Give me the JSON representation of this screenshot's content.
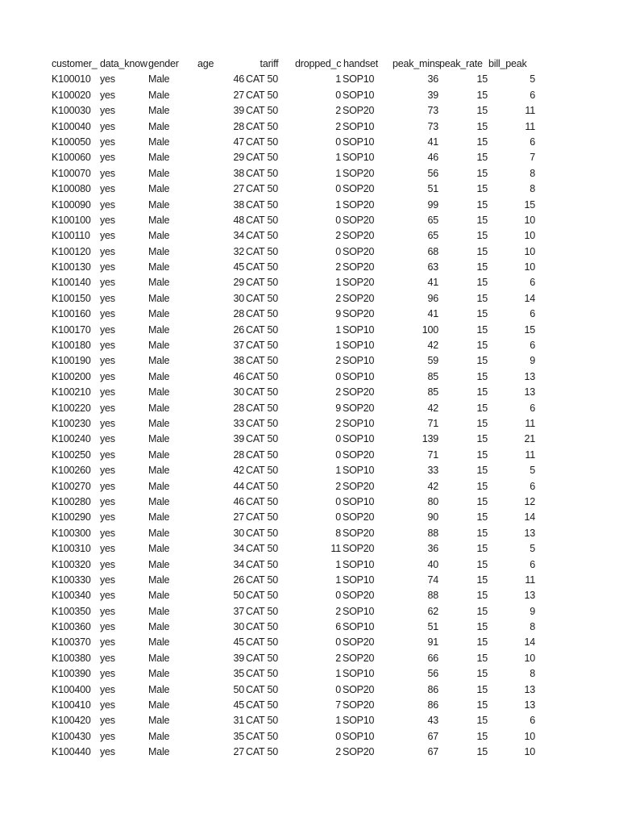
{
  "sheet": {
    "headers": [
      "customer_",
      "data_know",
      "gender",
      "age",
      "tariff",
      "dropped_c",
      "handset",
      "peak_mins",
      "peak_rate",
      "bill_peak"
    ],
    "rows": [
      [
        "K100010",
        "yes",
        "Male",
        "46",
        "CAT 50",
        "1",
        "SOP10",
        "36",
        "15",
        "5"
      ],
      [
        "K100020",
        "yes",
        "Male",
        "27",
        "CAT 50",
        "0",
        "SOP10",
        "39",
        "15",
        "6"
      ],
      [
        "K100030",
        "yes",
        "Male",
        "39",
        "CAT 50",
        "2",
        "SOP20",
        "73",
        "15",
        "11"
      ],
      [
        "K100040",
        "yes",
        "Male",
        "28",
        "CAT 50",
        "2",
        "SOP10",
        "73",
        "15",
        "11"
      ],
      [
        "K100050",
        "yes",
        "Male",
        "47",
        "CAT 50",
        "0",
        "SOP10",
        "41",
        "15",
        "6"
      ],
      [
        "K100060",
        "yes",
        "Male",
        "29",
        "CAT 50",
        "1",
        "SOP10",
        "46",
        "15",
        "7"
      ],
      [
        "K100070",
        "yes",
        "Male",
        "38",
        "CAT 50",
        "1",
        "SOP20",
        "56",
        "15",
        "8"
      ],
      [
        "K100080",
        "yes",
        "Male",
        "27",
        "CAT 50",
        "0",
        "SOP20",
        "51",
        "15",
        "8"
      ],
      [
        "K100090",
        "yes",
        "Male",
        "38",
        "CAT 50",
        "1",
        "SOP20",
        "99",
        "15",
        "15"
      ],
      [
        "K100100",
        "yes",
        "Male",
        "48",
        "CAT 50",
        "0",
        "SOP20",
        "65",
        "15",
        "10"
      ],
      [
        "K100110",
        "yes",
        "Male",
        "34",
        "CAT 50",
        "2",
        "SOP20",
        "65",
        "15",
        "10"
      ],
      [
        "K100120",
        "yes",
        "Male",
        "32",
        "CAT 50",
        "0",
        "SOP20",
        "68",
        "15",
        "10"
      ],
      [
        "K100130",
        "yes",
        "Male",
        "45",
        "CAT 50",
        "2",
        "SOP20",
        "63",
        "15",
        "10"
      ],
      [
        "K100140",
        "yes",
        "Male",
        "29",
        "CAT 50",
        "1",
        "SOP20",
        "41",
        "15",
        "6"
      ],
      [
        "K100150",
        "yes",
        "Male",
        "30",
        "CAT 50",
        "2",
        "SOP20",
        "96",
        "15",
        "14"
      ],
      [
        "K100160",
        "yes",
        "Male",
        "28",
        "CAT 50",
        "9",
        "SOP20",
        "41",
        "15",
        "6"
      ],
      [
        "K100170",
        "yes",
        "Male",
        "26",
        "CAT 50",
        "1",
        "SOP10",
        "100",
        "15",
        "15"
      ],
      [
        "K100180",
        "yes",
        "Male",
        "37",
        "CAT 50",
        "1",
        "SOP10",
        "42",
        "15",
        "6"
      ],
      [
        "K100190",
        "yes",
        "Male",
        "38",
        "CAT 50",
        "2",
        "SOP10",
        "59",
        "15",
        "9"
      ],
      [
        "K100200",
        "yes",
        "Male",
        "46",
        "CAT 50",
        "0",
        "SOP10",
        "85",
        "15",
        "13"
      ],
      [
        "K100210",
        "yes",
        "Male",
        "30",
        "CAT 50",
        "2",
        "SOP20",
        "85",
        "15",
        "13"
      ],
      [
        "K100220",
        "yes",
        "Male",
        "28",
        "CAT 50",
        "9",
        "SOP20",
        "42",
        "15",
        "6"
      ],
      [
        "K100230",
        "yes",
        "Male",
        "33",
        "CAT 50",
        "2",
        "SOP10",
        "71",
        "15",
        "11"
      ],
      [
        "K100240",
        "yes",
        "Male",
        "39",
        "CAT 50",
        "0",
        "SOP10",
        "139",
        "15",
        "21"
      ],
      [
        "K100250",
        "yes",
        "Male",
        "28",
        "CAT 50",
        "0",
        "SOP20",
        "71",
        "15",
        "11"
      ],
      [
        "K100260",
        "yes",
        "Male",
        "42",
        "CAT 50",
        "1",
        "SOP10",
        "33",
        "15",
        "5"
      ],
      [
        "K100270",
        "yes",
        "Male",
        "44",
        "CAT 50",
        "2",
        "SOP20",
        "42",
        "15",
        "6"
      ],
      [
        "K100280",
        "yes",
        "Male",
        "46",
        "CAT 50",
        "0",
        "SOP10",
        "80",
        "15",
        "12"
      ],
      [
        "K100290",
        "yes",
        "Male",
        "27",
        "CAT 50",
        "0",
        "SOP20",
        "90",
        "15",
        "14"
      ],
      [
        "K100300",
        "yes",
        "Male",
        "30",
        "CAT 50",
        "8",
        "SOP20",
        "88",
        "15",
        "13"
      ],
      [
        "K100310",
        "yes",
        "Male",
        "34",
        "CAT 50",
        "11",
        "SOP20",
        "36",
        "15",
        "5"
      ],
      [
        "K100320",
        "yes",
        "Male",
        "34",
        "CAT 50",
        "1",
        "SOP10",
        "40",
        "15",
        "6"
      ],
      [
        "K100330",
        "yes",
        "Male",
        "26",
        "CAT 50",
        "1",
        "SOP10",
        "74",
        "15",
        "11"
      ],
      [
        "K100340",
        "yes",
        "Male",
        "50",
        "CAT 50",
        "0",
        "SOP20",
        "88",
        "15",
        "13"
      ],
      [
        "K100350",
        "yes",
        "Male",
        "37",
        "CAT 50",
        "2",
        "SOP10",
        "62",
        "15",
        "9"
      ],
      [
        "K100360",
        "yes",
        "Male",
        "30",
        "CAT 50",
        "6",
        "SOP10",
        "51",
        "15",
        "8"
      ],
      [
        "K100370",
        "yes",
        "Male",
        "45",
        "CAT 50",
        "0",
        "SOP20",
        "91",
        "15",
        "14"
      ],
      [
        "K100380",
        "yes",
        "Male",
        "39",
        "CAT 50",
        "2",
        "SOP20",
        "66",
        "15",
        "10"
      ],
      [
        "K100390",
        "yes",
        "Male",
        "35",
        "CAT 50",
        "1",
        "SOP10",
        "56",
        "15",
        "8"
      ],
      [
        "K100400",
        "yes",
        "Male",
        "50",
        "CAT 50",
        "0",
        "SOP20",
        "86",
        "15",
        "13"
      ],
      [
        "K100410",
        "yes",
        "Male",
        "45",
        "CAT 50",
        "7",
        "SOP20",
        "86",
        "15",
        "13"
      ],
      [
        "K100420",
        "yes",
        "Male",
        "31",
        "CAT 50",
        "1",
        "SOP10",
        "43",
        "15",
        "6"
      ],
      [
        "K100430",
        "yes",
        "Male",
        "35",
        "CAT 50",
        "0",
        "SOP10",
        "67",
        "15",
        "10"
      ],
      [
        "K100440",
        "yes",
        "Male",
        "27",
        "CAT 50",
        "2",
        "SOP20",
        "67",
        "15",
        "10"
      ]
    ]
  }
}
